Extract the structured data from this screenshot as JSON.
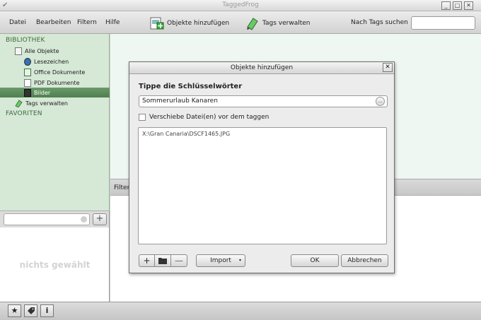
{
  "window": {
    "title": "TaggedFrog"
  },
  "menubar": {
    "items": [
      "Datei",
      "Bearbeiten",
      "Filtern",
      "Hilfe"
    ]
  },
  "toolbar": {
    "add_objects_label": "Objekte hinzufügen",
    "manage_tags_label": "Tags verwalten",
    "search_label": "Nach Tags suchen",
    "search_value": ""
  },
  "sidebar": {
    "library_header": "BIBLIOTHEK",
    "items": [
      {
        "label": "Alle Objekte",
        "icon": "all-objects-icon"
      },
      {
        "label": "Lesezeichen",
        "icon": "bookmark-icon"
      },
      {
        "label": "Office Dokumente",
        "icon": "office-document-icon"
      },
      {
        "label": "PDF Dokumente",
        "icon": "pdf-document-icon"
      },
      {
        "label": "Bilder",
        "icon": "images-icon",
        "selected": true
      },
      {
        "label": "Tags verwalten",
        "icon": "tag-pencil-icon"
      }
    ],
    "favorites_header": "FAVORITEN"
  },
  "left_panel": {
    "search_value": "",
    "info_text": "nichts gewählt"
  },
  "main": {
    "filter_label": "Filter"
  },
  "bottombar": {
    "buttons": [
      "star-icon",
      "tags-icon",
      "info-icon"
    ],
    "info_glyph": "i"
  },
  "dialog": {
    "title": "Objekte hinzufügen",
    "heading": "Tippe die Schlüsselwörter",
    "keywords_value": "Sommerurlaub Kanaren",
    "keywords_more": "...",
    "move_files_label": "Verschiebe Datei(en) vor dem taggen",
    "move_files_checked": false,
    "files": [
      "X:\\Gran Canaria\\DSCF1465.JPG"
    ],
    "import_label": "Import",
    "ok_label": "OK",
    "cancel_label": "Abbrechen"
  },
  "colors": {
    "sidebar_bg": "#d6e8d6",
    "selection": "#5a8a5a",
    "header_text": "#3d6a3d",
    "main_bg": "#eef7f1"
  }
}
